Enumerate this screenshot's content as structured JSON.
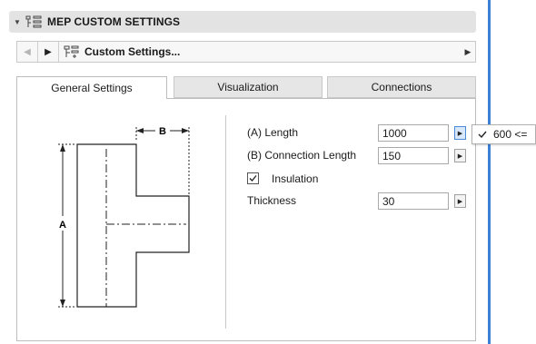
{
  "header": {
    "title": "MEP CUSTOM SETTINGS"
  },
  "nav": {
    "preset_label": "Custom Settings..."
  },
  "tabs": [
    {
      "label": "General Settings",
      "active": true
    },
    {
      "label": "Visualization",
      "active": false
    },
    {
      "label": "Connections",
      "active": false
    }
  ],
  "settings": {
    "length": {
      "label": "(A) Length",
      "value": "1000"
    },
    "connection_length": {
      "label": "(B) Connection Length",
      "value": "150"
    },
    "insulation": {
      "label": "Insulation",
      "checked": true
    },
    "thickness": {
      "label": "Thickness",
      "value": "30"
    }
  },
  "diagram": {
    "label_a": "A",
    "label_b": "B"
  },
  "popup": {
    "item": "600 <=",
    "checked": true
  },
  "colors": {
    "accent_blue": "#3b82d6",
    "header_bg": "#e3e3e3",
    "tab_inactive": "#e6e6e6"
  }
}
